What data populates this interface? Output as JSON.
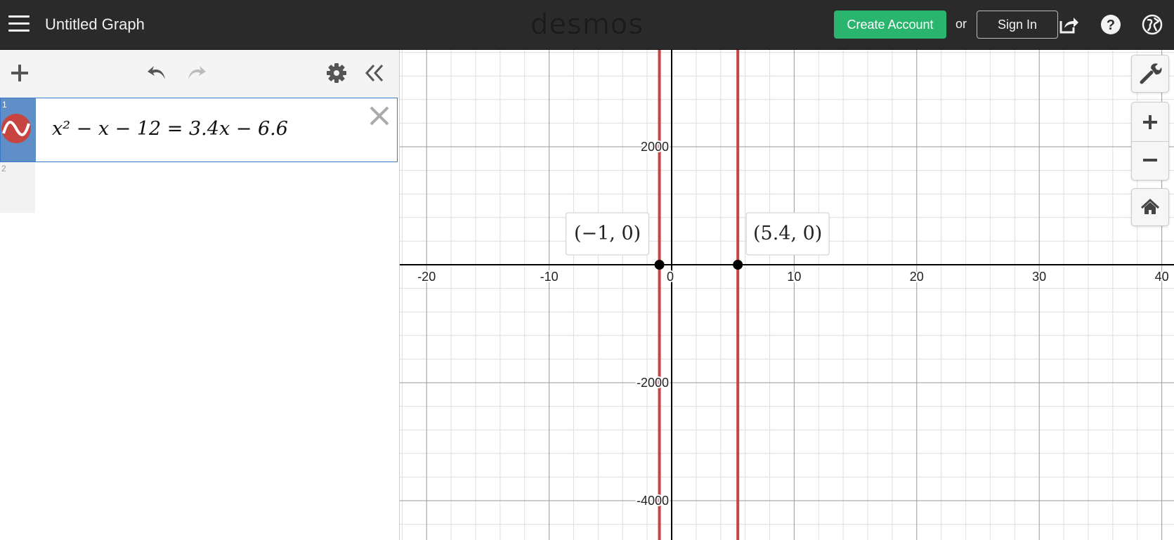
{
  "header": {
    "title": "Untitled Graph",
    "logo": "desmos",
    "create_account": "Create Account",
    "or": "or",
    "sign_in": "Sign In"
  },
  "expressions": [
    {
      "index": "1",
      "latex_display": "x² − x − 12 = 3.4x − 6.6",
      "color": "#c74440"
    },
    {
      "index": "2",
      "latex_display": ""
    }
  ],
  "graph": {
    "x_ticks": [
      "-20",
      "-10",
      "0",
      "10",
      "20",
      "30",
      "40"
    ],
    "y_ticks": [
      "2000",
      "-2000",
      "-4000"
    ],
    "points": [
      {
        "x": -1,
        "y": 0,
        "label": "(−1, 0)"
      },
      {
        "x": 5.4,
        "y": 0,
        "label": "(5.4, 0)"
      }
    ],
    "vertical_lines_x": [
      -1,
      5.4
    ],
    "curve_color": "#c74440"
  },
  "colors": {
    "topbar": "#2a2a2a",
    "accent_green": "#2ab56f",
    "gutter_blue": "#5f8fc6"
  },
  "icons": [
    "menu-icon",
    "share-icon",
    "help-icon",
    "globe-icon",
    "plus-icon",
    "undo-icon",
    "redo-icon",
    "gear-icon",
    "collapse-icon",
    "close-icon",
    "wrench-icon",
    "zoom-in-icon",
    "zoom-out-icon",
    "home-icon"
  ]
}
